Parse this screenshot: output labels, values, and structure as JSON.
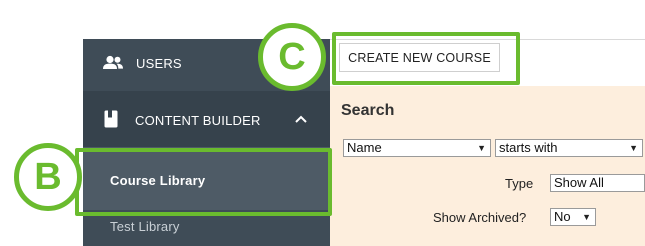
{
  "sidebar": {
    "items": [
      {
        "label": "USERS",
        "icon": "users-icon"
      },
      {
        "label": "CONTENT BUILDER",
        "icon": "book-icon",
        "expanded": true
      },
      {
        "label": "Course Library",
        "selected": true
      },
      {
        "label": "Test Library"
      }
    ]
  },
  "toolbar": {
    "create_label": "CREATE NEW COURSE"
  },
  "search": {
    "title": "Search",
    "field_select": "Name",
    "operator_select": "starts with",
    "type_label": "Type",
    "type_select": "Show All",
    "archived_label": "Show Archived?",
    "archived_select": "No"
  },
  "callouts": {
    "b": "B",
    "c": "C"
  },
  "colors": {
    "callout_green": "#6abb2e",
    "sidebar_bg": "#3f4c57",
    "search_bg": "#fdeedd"
  }
}
